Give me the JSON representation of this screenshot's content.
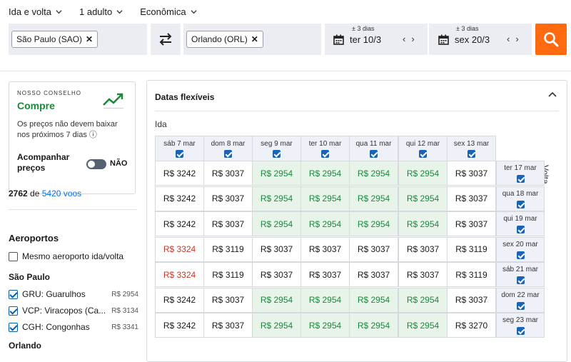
{
  "topbar": {
    "trip_type": "Ida e volta",
    "passengers": "1 adulto",
    "cabin": "Econômica"
  },
  "search": {
    "origin": "São Paulo (SAO)",
    "destination": "Orlando (ORL)",
    "depart_flex": "± 3 dias",
    "depart_date": "ter 10/3",
    "return_flex": "± 3 dias",
    "return_date": "sex 20/3"
  },
  "advice": {
    "label": "NOSSO CONSELHO",
    "verdict": "Compre",
    "description": "Os preços não devem baixar nos próximos 7 dias",
    "info_icon": "ⓘ",
    "track_label": "Acompanhar preços",
    "toggle_state": "NÃO"
  },
  "results": {
    "shown": "2762",
    "of": "de",
    "total": "5420 voos"
  },
  "filters": {
    "airports_title": "Aeroportos",
    "same_airport": "Mesmo aeroporto ida/volta",
    "group1_title": "São Paulo",
    "group1": [
      {
        "label": "GRU: Guarulhos",
        "price": "R$ 2954"
      },
      {
        "label": "VCP: Viracopos (Ca...",
        "price": "R$ 3134"
      },
      {
        "label": "CGH: Congonhas",
        "price": "R$ 3341"
      }
    ],
    "group2_title": "Orlando"
  },
  "flex": {
    "title": "Datas flexíveis",
    "ida_label": "Ida",
    "volta_label": "Volta",
    "columns": [
      "sáb 7 mar",
      "dom 8 mar",
      "seg 9 mar",
      "ter 10 mar",
      "qua 11 mar",
      "qui 12 mar",
      "sex 13 mar"
    ],
    "rows": [
      {
        "date": "ter 17 mar",
        "prices": [
          "R$ 3242",
          "R$ 3037",
          "R$ 2954",
          "R$ 2954",
          "R$ 2954",
          "R$ 2954",
          "R$ 3037"
        ]
      },
      {
        "date": "qua 18 mar",
        "prices": [
          "R$ 3242",
          "R$ 3037",
          "R$ 2954",
          "R$ 2954",
          "R$ 2954",
          "R$ 2954",
          "R$ 3037"
        ]
      },
      {
        "date": "qui 19 mar",
        "prices": [
          "R$ 3242",
          "R$ 3037",
          "R$ 2954",
          "R$ 2954",
          "R$ 2954",
          "R$ 2954",
          "R$ 3037"
        ]
      },
      {
        "date": "sex 20 mar",
        "prices": [
          "R$ 3324",
          "R$ 3119",
          "R$ 3037",
          "R$ 3037",
          "R$ 3037",
          "R$ 3037",
          "R$ 3119"
        ]
      },
      {
        "date": "sáb 21 mar",
        "prices": [
          "R$ 3324",
          "R$ 3119",
          "R$ 3037",
          "R$ 3037",
          "R$ 3037",
          "R$ 3037",
          "R$ 3119"
        ]
      },
      {
        "date": "dom 22 mar",
        "prices": [
          "R$ 3242",
          "R$ 3037",
          "R$ 2954",
          "R$ 2954",
          "R$ 2954",
          "R$ 2954",
          "R$ 3037"
        ]
      },
      {
        "date": "seg 23 mar",
        "prices": [
          "R$ 3242",
          "R$ 3037",
          "R$ 2954",
          "R$ 2954",
          "R$ 2954",
          "R$ 2954",
          "R$ 3270"
        ]
      }
    ],
    "colors": {
      "cheap": "#1b8a3c",
      "cheap_bg": "#e8f3ea",
      "expensive": "#c0392b"
    }
  },
  "colors": {
    "accent": "#ff690f",
    "link": "#0770e3",
    "checkbox": "#1a63b5"
  }
}
